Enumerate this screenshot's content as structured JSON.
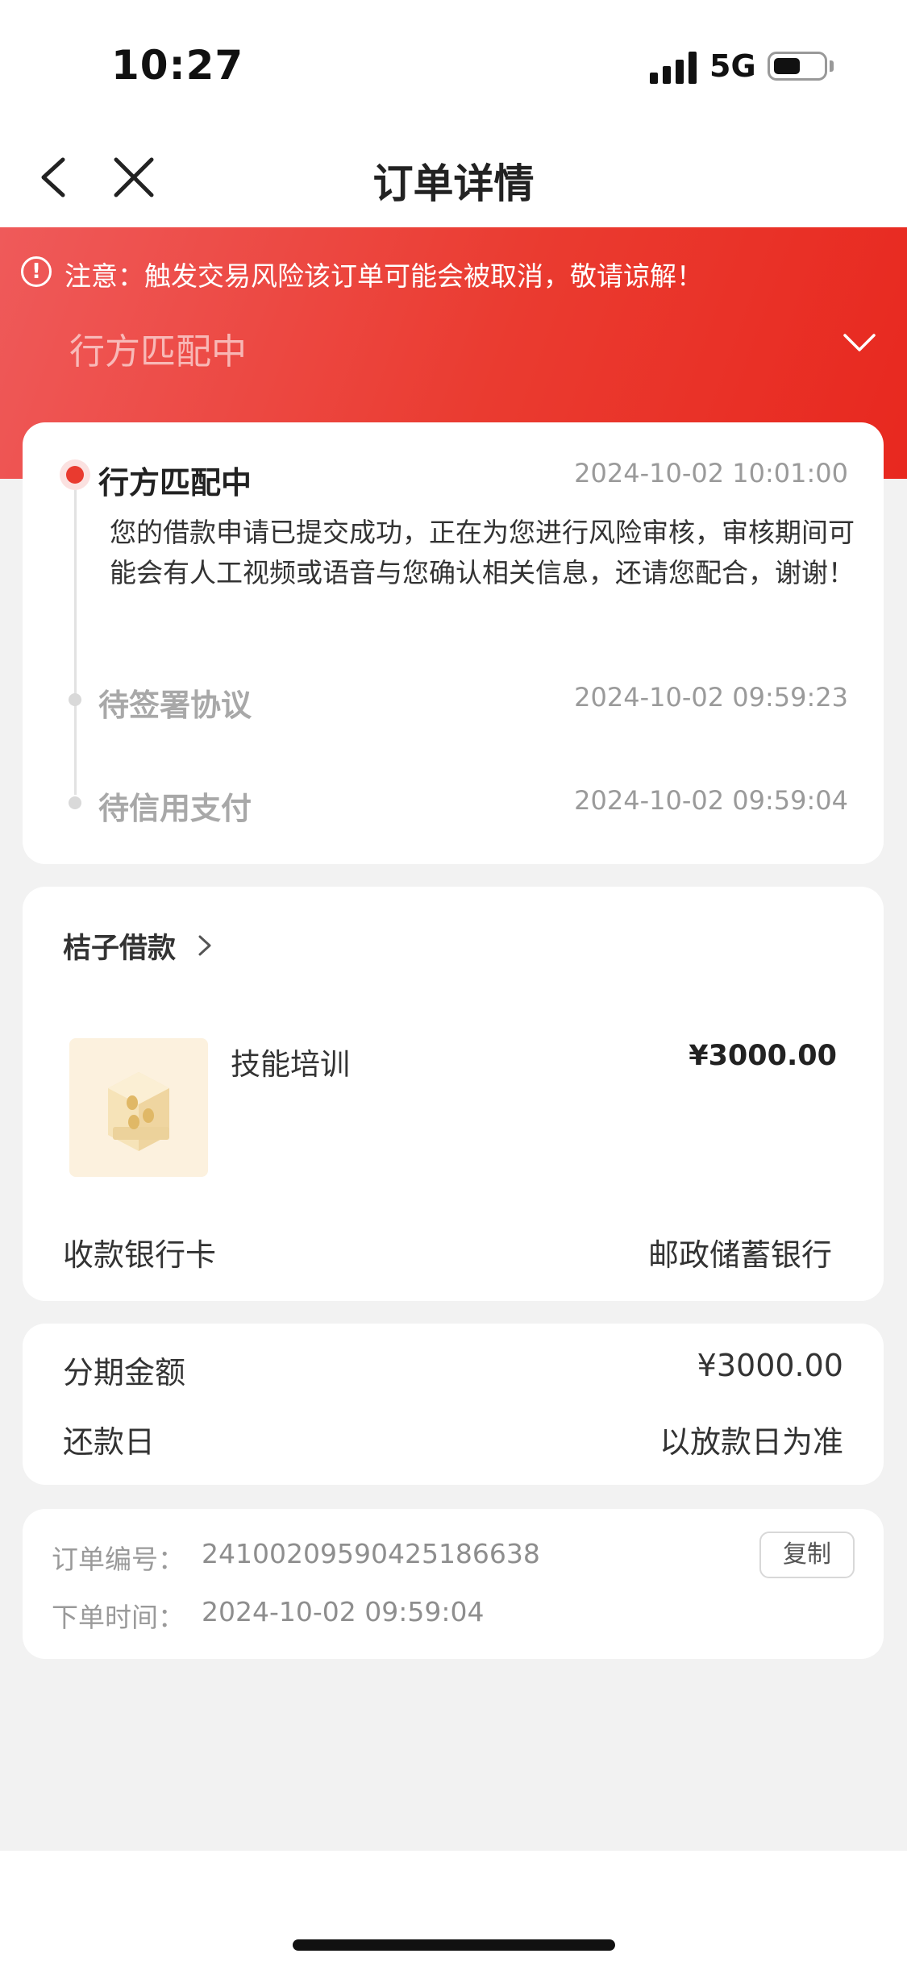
{
  "status_bar": {
    "time": "10:27",
    "network": "5G",
    "battery_level": 0.45
  },
  "nav": {
    "title": "订单详情"
  },
  "alert": {
    "text": "注意：触发交易风险该订单可能会被取消，敬请谅解！"
  },
  "header": {
    "status": "行方匹配中"
  },
  "timeline": [
    {
      "title": "行方匹配中",
      "time": "2024-10-02 10:01:00",
      "description": "您的借款申请已提交成功，正在为您进行风险审核，审核期间可能会有人工视频或语音与您确认相关信息，还请您配合，谢谢！"
    },
    {
      "title": "待签署协议",
      "time": "2024-10-02 09:59:23"
    },
    {
      "title": "待信用支付",
      "time": "2024-10-02 09:59:04"
    }
  ],
  "product": {
    "merchant": "桔子借款",
    "name": "技能培训",
    "price": "¥3000.00",
    "bank_label": "收款银行卡",
    "bank_value": "邮政储蓄银行"
  },
  "installment": {
    "amount_label": "分期金额",
    "amount_value": "¥3000.00",
    "repay_label": "还款日",
    "repay_value": "以放款日为准"
  },
  "order": {
    "number_label": "订单编号：",
    "number_value": "24100209590425186638",
    "copy_label": "复制",
    "time_label": "下单时间：",
    "time_value": "2024-10-02 09:59:04"
  },
  "colors": {
    "accent": "#e93a2f",
    "header_start": "#ef5a5a",
    "header_end": "#e8281f"
  }
}
